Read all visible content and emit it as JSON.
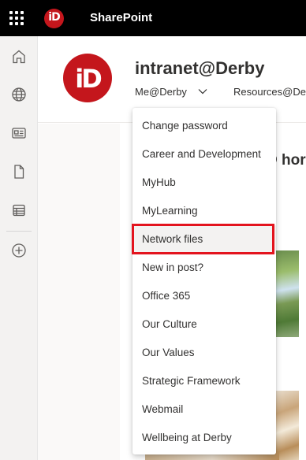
{
  "topbar": {
    "logo_text": "iD",
    "app_name": "SharePoint"
  },
  "leftbar": {
    "items": [
      {
        "icon": "home-icon"
      },
      {
        "icon": "globe-icon"
      },
      {
        "icon": "news-icon"
      },
      {
        "icon": "document-icon"
      },
      {
        "icon": "list-icon"
      },
      {
        "icon": "add-icon"
      }
    ]
  },
  "site": {
    "logo_text": "iD",
    "title": "intranet@Derby",
    "nav": {
      "me_label": "Me@Derby",
      "resources_label": "Resources@De"
    }
  },
  "content": {
    "heading_fragment": "D hor"
  },
  "menu": {
    "items": [
      {
        "label": "Change password"
      },
      {
        "label": "Career and Development"
      },
      {
        "label": "MyHub"
      },
      {
        "label": "MyLearning"
      },
      {
        "label": "Network files"
      },
      {
        "label": "New in post?"
      },
      {
        "label": "Office 365"
      },
      {
        "label": "Our Culture"
      },
      {
        "label": "Our Values"
      },
      {
        "label": "Strategic Framework"
      },
      {
        "label": "Webmail"
      },
      {
        "label": "Wellbeing at Derby"
      }
    ]
  },
  "colors": {
    "brand_red": "#c4161c",
    "highlight_red": "#e3141e",
    "topbar": "#000000"
  }
}
